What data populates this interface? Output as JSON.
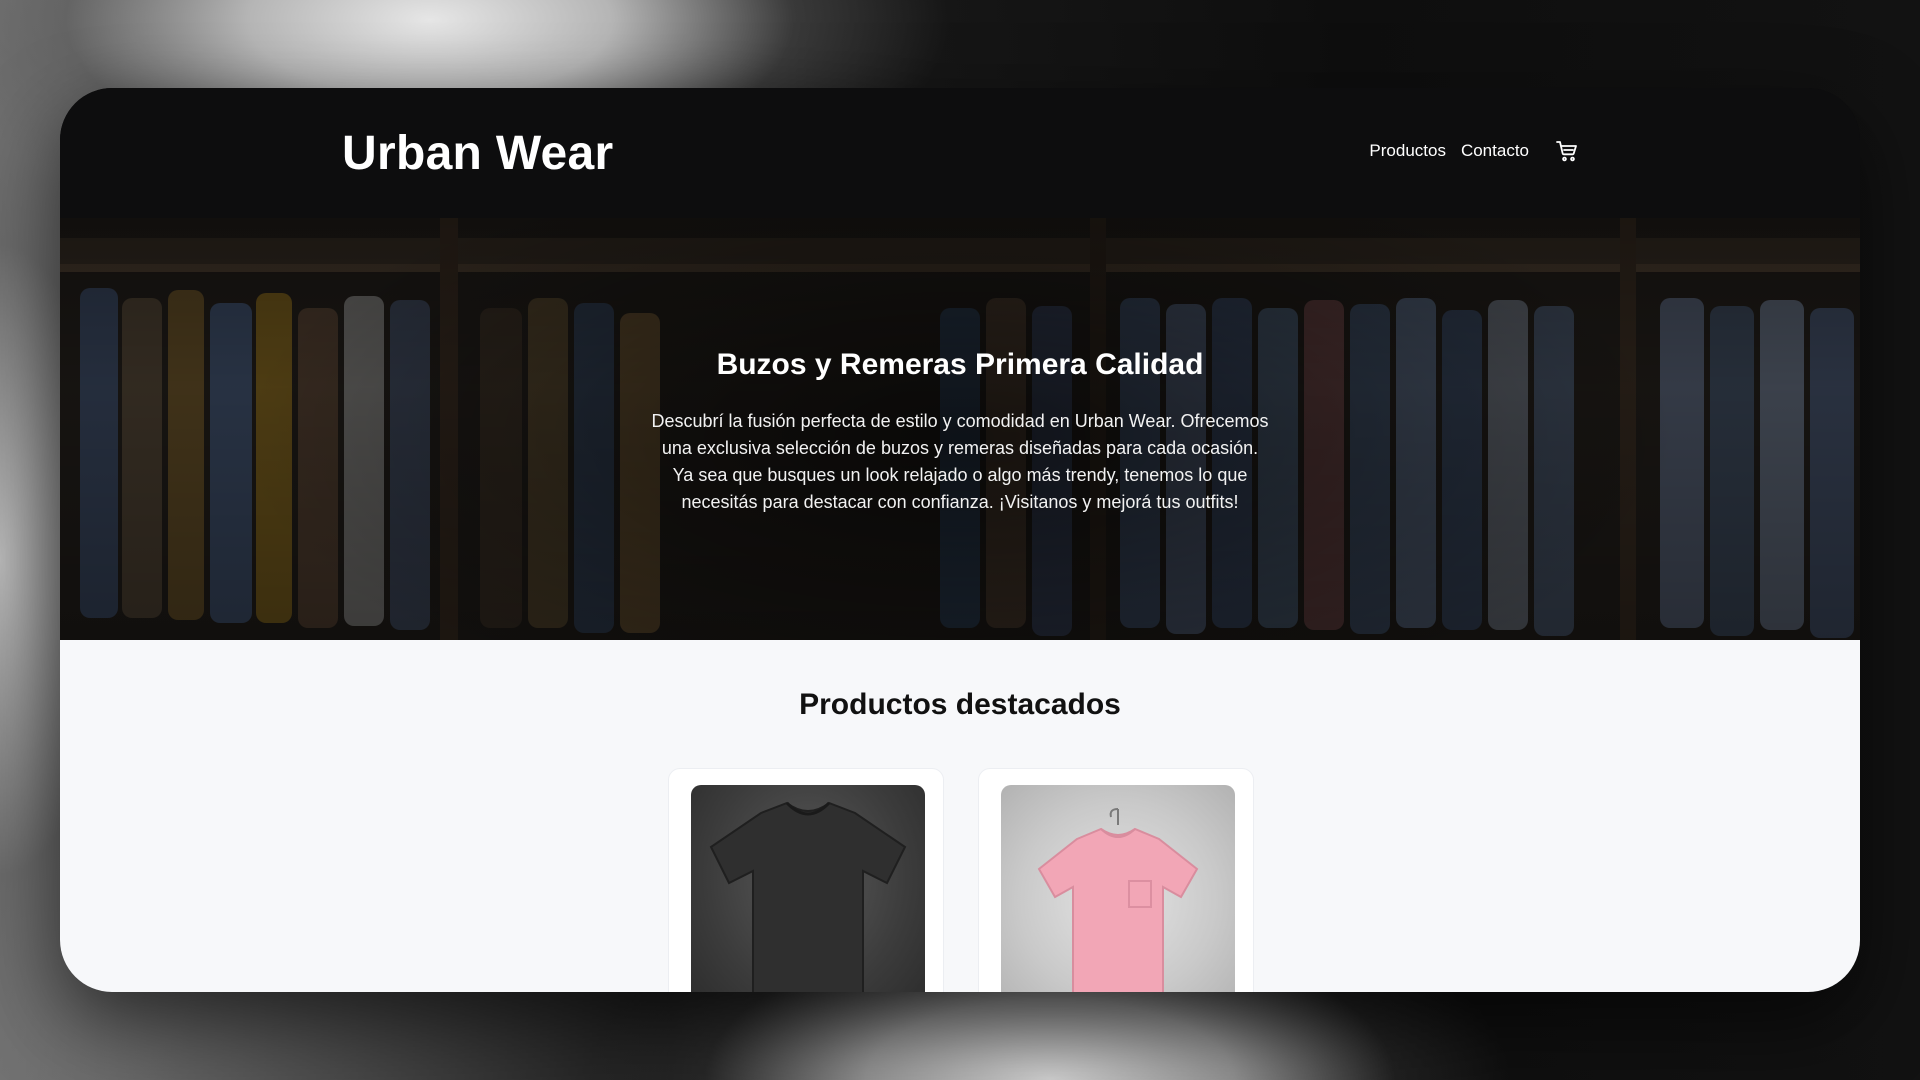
{
  "header": {
    "brand": "Urban Wear",
    "nav": [
      {
        "label": "Productos"
      },
      {
        "label": "Contacto"
      }
    ],
    "cart_icon": "shopping-cart-icon"
  },
  "hero": {
    "title": "Buzos y Remeras Primera Calidad",
    "lines": [
      "Descubrí la fusión perfecta de estilo y comodidad en Urban Wear. Ofrecemos",
      "una exclusiva selección de buzos y remeras diseñadas para cada ocasión.",
      "Ya sea que busques un look relajado o algo más trendy, tenemos lo que",
      "necesitás para destacar con confianza. ¡Visitanos y mejorá tus outfits!"
    ]
  },
  "featured": {
    "title": "Productos destacados",
    "products": [
      {
        "image": "black-tshirt",
        "color": "#2f2f2f"
      },
      {
        "image": "pink-tshirt-on-hanger",
        "color": "#f2a6b6"
      }
    ]
  },
  "colors": {
    "header_bg": "#0d0d0e",
    "section_bg": "#f7f8fa",
    "text_dark": "#111111",
    "text_light": "#ffffff"
  }
}
